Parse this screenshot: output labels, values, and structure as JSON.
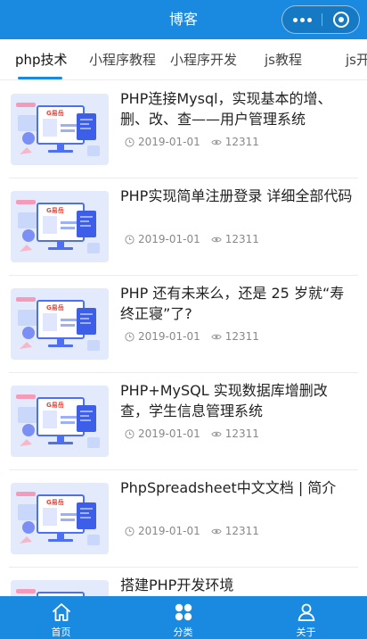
{
  "header": {
    "title": "博客"
  },
  "tabs": [
    {
      "label": "php技术",
      "active": true
    },
    {
      "label": "小程序教程",
      "active": false
    },
    {
      "label": "小程序开发",
      "active": false
    },
    {
      "label": "js教程",
      "active": false
    },
    {
      "label": "js开",
      "active": false
    }
  ],
  "articles": [
    {
      "title": "PHP连接Mysql，实现基本的增、删、改、查——用户管理系统",
      "date": "2019-01-01",
      "views": "12311",
      "thumb_logo": "G易岳"
    },
    {
      "title": "PHP实现简单注册登录 详细全部代码",
      "date": "2019-01-01",
      "views": "12311",
      "thumb_logo": "G易岳"
    },
    {
      "title": "PHP 还有未来么，还是 25 岁就“寿终正寝”了?",
      "date": "2019-01-01",
      "views": "12311",
      "thumb_logo": "G易岳"
    },
    {
      "title": "PHP+MySQL 实现数据库增删改查，学生信息管理系统",
      "date": "2019-01-01",
      "views": "12311",
      "thumb_logo": "G易岳"
    },
    {
      "title": "PhpSpreadsheet中文文档 | 简介",
      "date": "2019-01-01",
      "views": "12311",
      "thumb_logo": "G易岳"
    },
    {
      "title": "搭建PHP开发环境",
      "date": "",
      "views": "",
      "thumb_logo": "G易岳"
    }
  ],
  "tabbar": [
    {
      "label": "首页",
      "icon": "home-icon"
    },
    {
      "label": "分类",
      "icon": "category-grid-icon"
    },
    {
      "label": "关于",
      "icon": "user-icon"
    }
  ],
  "colors": {
    "primary": "#1a8ae0",
    "thumb_bg": "#e3eafc"
  }
}
